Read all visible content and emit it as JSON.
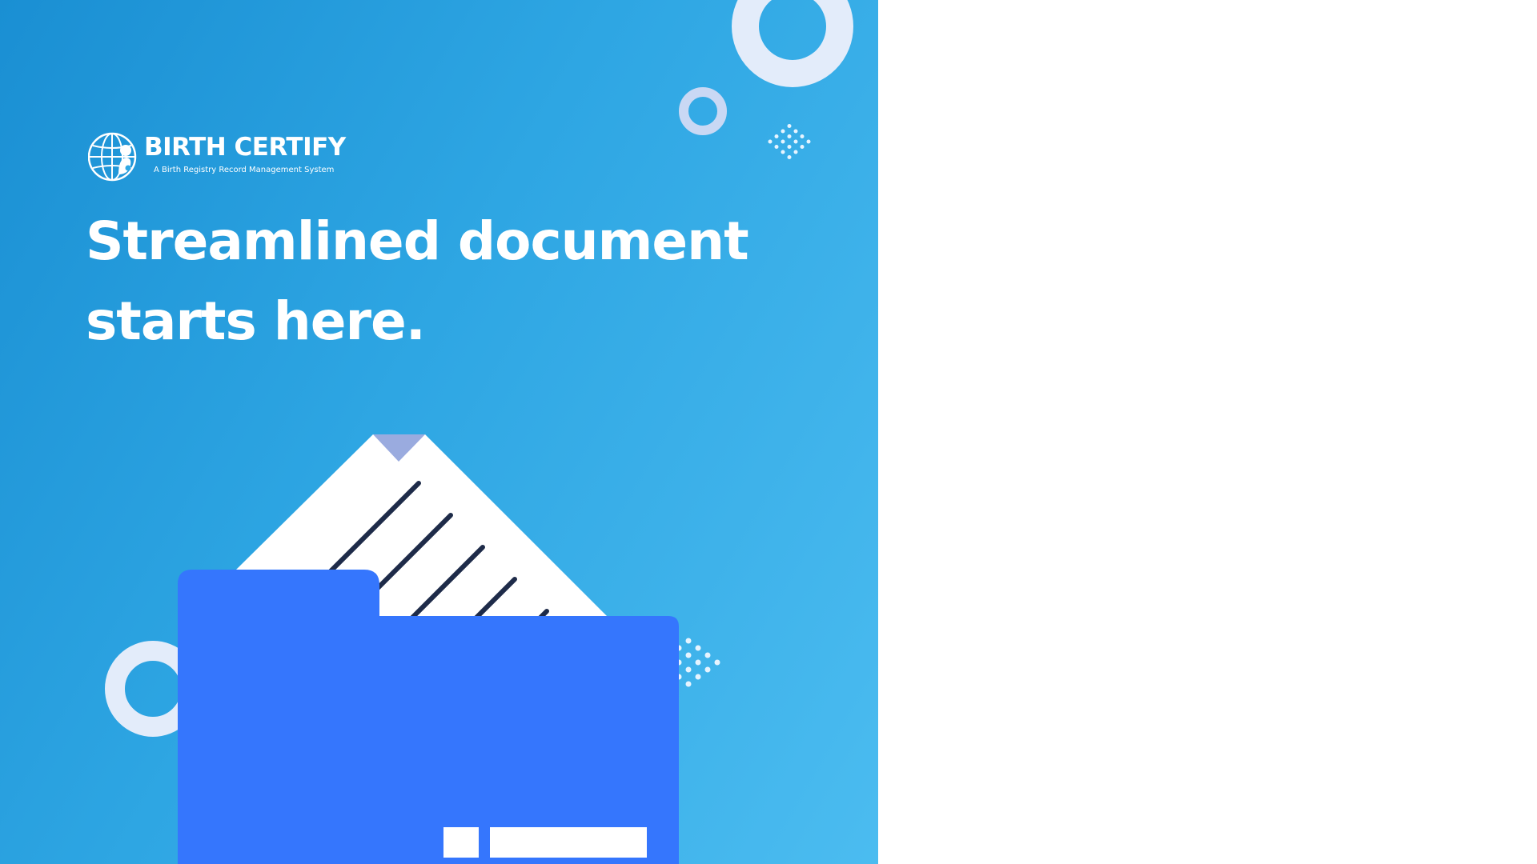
{
  "brand": {
    "name": "BIRTH CERTIFY",
    "tagline": "A Birth Registry Record  Management System",
    "logo_icon": "globe-with-figures-icon"
  },
  "hero": {
    "headline": "Streamlined document starts here.",
    "illustration_icon": "folder-with-document-icon"
  },
  "colors": {
    "gradient_start": "#1a8fd3",
    "gradient_end": "#4bbcf0",
    "folder": "#3576fd",
    "paper": "#ffffff",
    "paper_lines": "#1e2b49",
    "paper_tab": "#9aabdf",
    "ring_light": "#e3ecfa",
    "ring_mid": "#c9d8f4",
    "page_background": "#ffffff"
  }
}
